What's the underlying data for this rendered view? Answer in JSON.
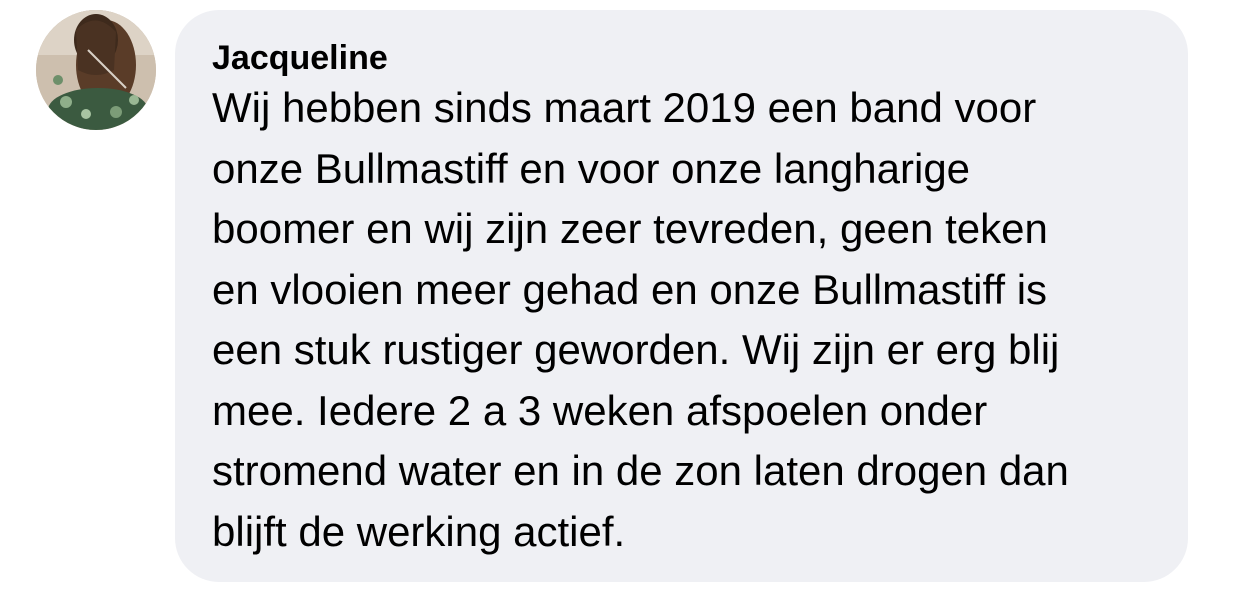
{
  "comment": {
    "author": "Jacqueline",
    "lines": [
      "Wij hebben sinds maart 2019 een band voor",
      "onze Bullmastiff en voor onze langharige",
      "boomer en wij zijn zeer tevreden, geen teken",
      "en vlooien meer gehad en onze Bullmastiff is",
      "een stuk rustiger geworden. Wij zijn er erg blij",
      "mee. Iedere 2 a 3 weken afspoelen onder",
      "stromend water en in de zon laten drogen dan",
      "blijft de werking actief."
    ]
  },
  "colors": {
    "bubble_background": "#eff0f4",
    "text": "#000000"
  },
  "avatar": {
    "icon": "profile-photo-horse"
  }
}
